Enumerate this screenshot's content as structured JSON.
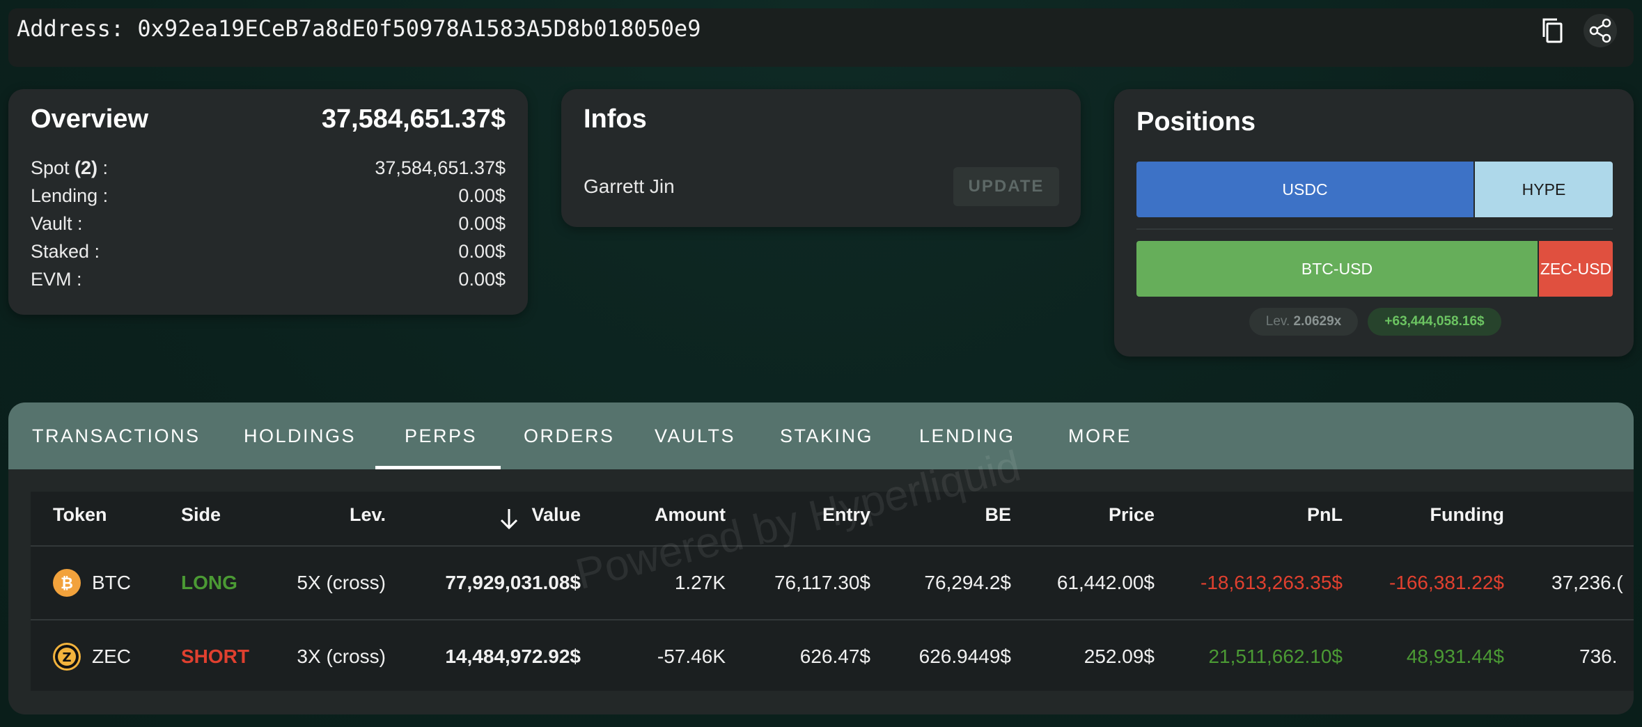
{
  "address": {
    "text": "Address: 0x92ea19ECeB7a8dE0f50978A1583A5D8b018050e9"
  },
  "icons": {
    "copy": "copy-icon",
    "share": "share-icon"
  },
  "overview": {
    "title": "Overview",
    "total": "37,584,651.37$",
    "rows": [
      {
        "label": "Spot ",
        "count": "(2)",
        "suffix": " :",
        "value": "37,584,651.37$"
      },
      {
        "label": "Lending :",
        "value": "0.00$"
      },
      {
        "label": "Vault :",
        "value": "0.00$"
      },
      {
        "label": "Staked :",
        "value": "0.00$"
      },
      {
        "label": "EVM :",
        "value": "0.00$"
      }
    ]
  },
  "infos": {
    "title": "Infos",
    "name": "Garrett Jin",
    "update_label": "UPDATE"
  },
  "positions": {
    "title": "Positions",
    "spot_bar": [
      {
        "label": "USDC",
        "share": 0.71,
        "color": "#3d72c6"
      },
      {
        "label": "HYPE",
        "share": 0.29,
        "color": "#aed8ea"
      }
    ],
    "perp_bar": [
      {
        "label": "BTC-USD",
        "share": 0.84,
        "color": "#66ae5a"
      },
      {
        "label": "ZEC-USD",
        "share": 0.16,
        "color": "#e0503f"
      }
    ],
    "lev_label": "Lev.",
    "lev_value": "2.0629x",
    "pnl": "+63,444,058.16$"
  },
  "tabs": [
    "TRANSACTIONS",
    "HOLDINGS",
    "PERPS",
    "ORDERS",
    "VAULTS",
    "STAKING",
    "LENDING",
    "MORE"
  ],
  "active_tab": "PERPS",
  "table": {
    "headers": [
      "Token",
      "Side",
      "Lev.",
      "Value",
      "Amount",
      "Entry",
      "BE",
      "Price",
      "PnL",
      "Funding"
    ],
    "sort_icon": "arrow-down-icon",
    "rows": [
      {
        "token": "BTC",
        "token_icon": "bitcoin-icon",
        "side": "LONG",
        "lev": "5X (cross)",
        "value": "77,929,031.08$",
        "amount": "1.27K",
        "entry": "76,117.30$",
        "be": "76,294.2$",
        "price": "61,442.00$",
        "pnl": "-18,613,263.35$",
        "funding": "-166,381.22$",
        "extra": "37,236.("
      },
      {
        "token": "ZEC",
        "token_icon": "zcash-icon",
        "side": "SHORT",
        "lev": "3X (cross)",
        "value": "14,484,972.92$",
        "amount": "-57.46K",
        "entry": "626.47$",
        "be": "626.9449$",
        "price": "252.09$",
        "pnl": "21,511,662.10$",
        "funding": "48,931.44$",
        "extra": "736."
      }
    ]
  },
  "watermark": "Powered by Hyperliquid"
}
